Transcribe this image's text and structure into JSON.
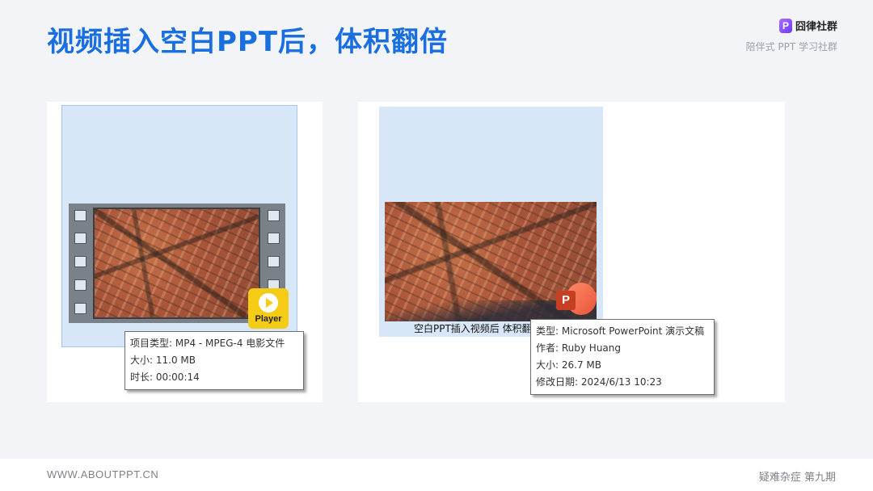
{
  "header": {
    "title": "视频插入空白PPT后，体积翻倍",
    "brand_name": "囧律社群",
    "brand_logo_letter": "P",
    "brand_subtitle": "陪伴式 PPT 学习社群"
  },
  "left_panel": {
    "badge_label": "Player",
    "tooltip": {
      "type": "项目类型: MP4 - MPEG-4 电影文件",
      "size": "大小: 11.0 MB",
      "duration": "时长: 00:00:14"
    }
  },
  "right_panel": {
    "caption": "空白PPT插入视频后 体积翻",
    "icon_letter": "P",
    "tooltip": {
      "type": "类型: Microsoft PowerPoint 演示文稿",
      "author": "作者: Ruby Huang",
      "size": "大小: 26.7 MB",
      "modified": "修改日期: 2024/6/13 10:23"
    }
  },
  "footer": {
    "url": "WWW.ABOUTPPT.CN",
    "issue": "疑难杂症 第九期"
  },
  "colors": {
    "title_blue": "#1a6fe0",
    "selection_blue": "#d7e7f7",
    "player_yellow": "#f4cc16",
    "ppt_orange": "#e8553a"
  }
}
